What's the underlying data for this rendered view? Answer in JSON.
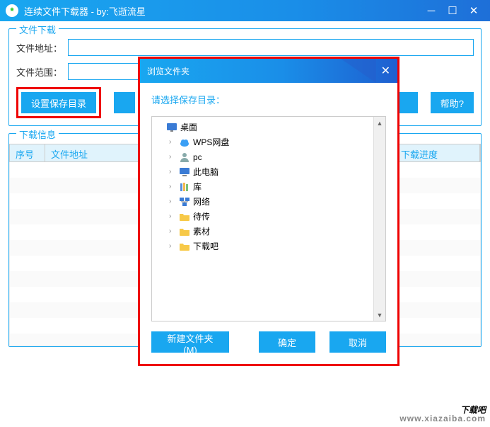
{
  "titlebar": {
    "title": "连续文件下载器 - by:飞逝流星"
  },
  "sections": {
    "download_group_title": "文件下载",
    "info_group_title": "下载信息"
  },
  "form": {
    "url_label": "文件地址：",
    "range_label": "文件范围：",
    "url_value": "",
    "range_value": ""
  },
  "buttons": {
    "set_save_dir": "设置保存目录",
    "help": "帮助?"
  },
  "table": {
    "col_seq": "序号",
    "col_url": "文件地址",
    "col_progress": "下载进度"
  },
  "modal": {
    "title": "浏览文件夹",
    "prompt": "请选择保存目录：",
    "new_folder": "新建文件夹(M)",
    "ok": "确定",
    "cancel": "取消"
  },
  "tree": {
    "desktop": "桌面",
    "items": [
      {
        "label": "WPS网盘",
        "icon": "cloud"
      },
      {
        "label": "pc",
        "icon": "user"
      },
      {
        "label": "此电脑",
        "icon": "pc"
      },
      {
        "label": "库",
        "icon": "lib"
      },
      {
        "label": "网络",
        "icon": "net"
      },
      {
        "label": "待传",
        "icon": "folder"
      },
      {
        "label": "素材",
        "icon": "folder"
      },
      {
        "label": "下载吧",
        "icon": "folder"
      }
    ]
  },
  "watermark": {
    "text": "下载吧",
    "url": "www.xiazaiba.com"
  }
}
